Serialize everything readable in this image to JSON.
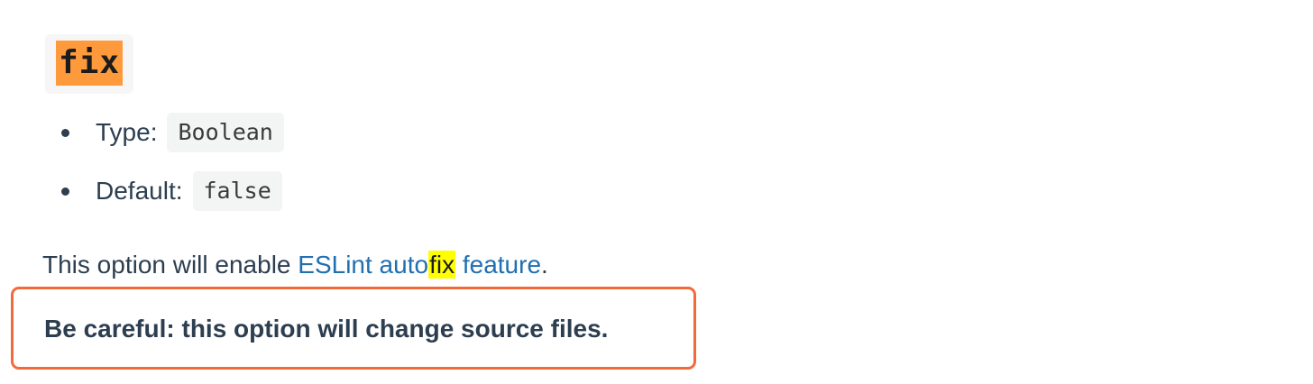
{
  "option": {
    "name": "fix",
    "type_label": "Type:",
    "type_value": "Boolean",
    "default_label": "Default:",
    "default_value": "false"
  },
  "description": {
    "prefix": "This option will enable ",
    "link_before": "ESLint auto",
    "link_highlight": "fix",
    "link_after": " feature",
    "suffix": "."
  },
  "warning": {
    "text": "Be careful: this option will change source files."
  },
  "colors": {
    "heading_highlight": "#ff9a3c",
    "search_highlight": "#ffff00",
    "link": "#1f6fb2",
    "callout_border": "#f26a3c"
  }
}
